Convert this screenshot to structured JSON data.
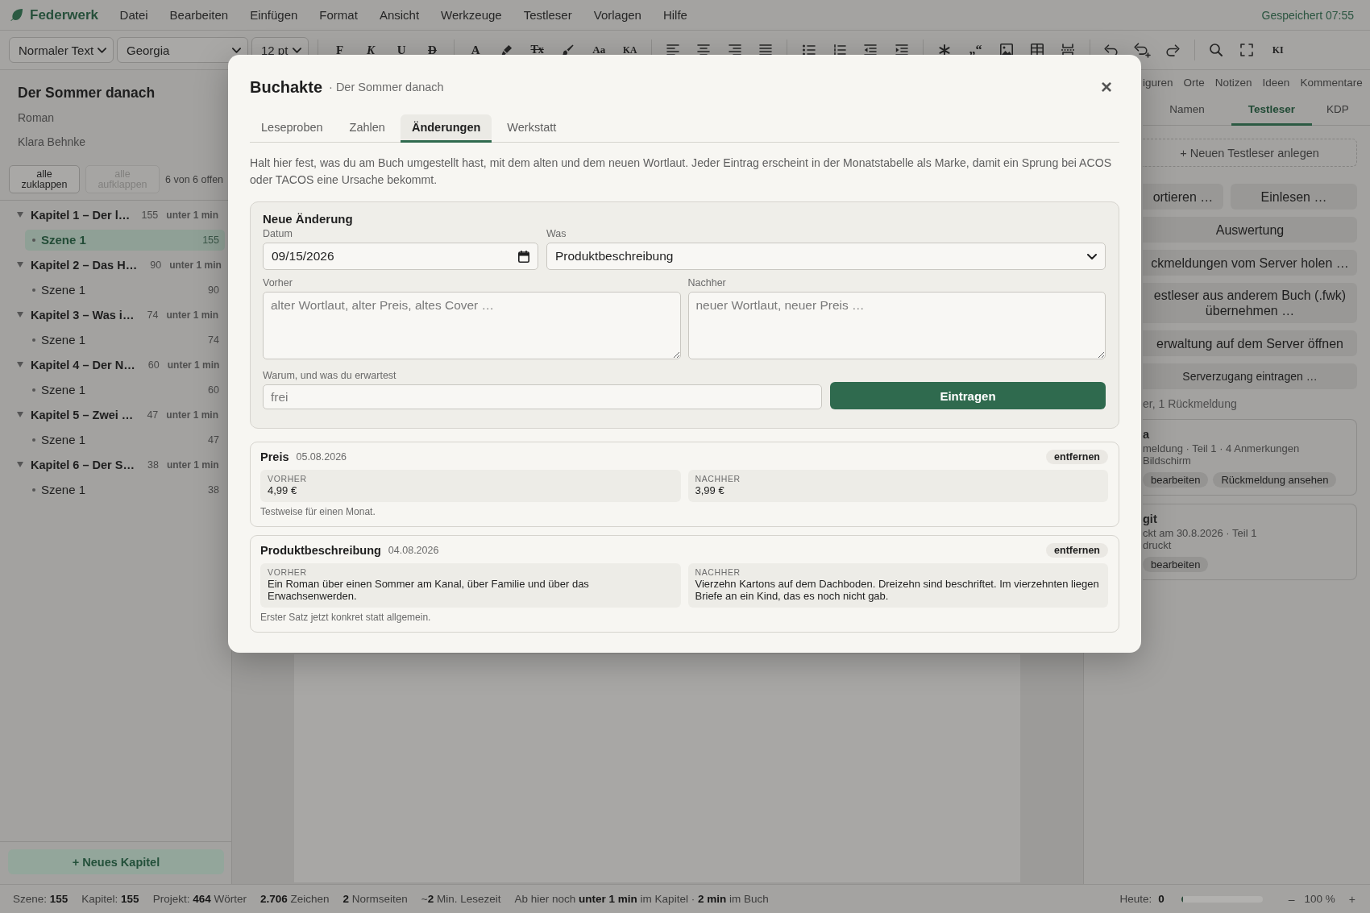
{
  "app": {
    "name": "Federwerk",
    "save_status": "Gespeichert 07:55"
  },
  "menu": [
    "Datei",
    "Bearbeiten",
    "Einfügen",
    "Format",
    "Ansicht",
    "Werkzeuge",
    "Testleser",
    "Vorlagen",
    "Hilfe"
  ],
  "toolbar": {
    "selects": [
      {
        "kind": "style",
        "value": "Normaler Text"
      },
      {
        "kind": "font",
        "value": "Georgia"
      },
      {
        "kind": "size",
        "value": "12 pt"
      }
    ],
    "groups": [
      [
        {
          "kind": "bold",
          "label": "F"
        },
        {
          "kind": "italic",
          "label": "K"
        },
        {
          "kind": "underline",
          "label": "U"
        },
        {
          "kind": "strike",
          "label": "D"
        }
      ],
      [
        {
          "kind": "color",
          "label": "A"
        },
        {
          "kind": "highlight"
        },
        {
          "kind": "clear",
          "label": "Tx"
        },
        {
          "kind": "brush"
        },
        {
          "kind": "case",
          "label": "Aa"
        },
        {
          "kind": "smallcaps",
          "label": "KA"
        }
      ],
      [
        {
          "kind": "align-left"
        },
        {
          "kind": "align-center"
        },
        {
          "kind": "align-right"
        },
        {
          "kind": "justify"
        }
      ],
      [
        {
          "kind": "bullets"
        },
        {
          "kind": "numbers"
        },
        {
          "kind": "outdent"
        },
        {
          "kind": "indent"
        }
      ],
      [
        {
          "kind": "special"
        },
        {
          "kind": "quotes",
          "label": "„“"
        },
        {
          "kind": "image"
        },
        {
          "kind": "table"
        },
        {
          "kind": "pagebreak"
        }
      ],
      [
        {
          "kind": "undo"
        },
        {
          "kind": "undo-all"
        },
        {
          "kind": "redo"
        }
      ],
      [
        {
          "kind": "search"
        },
        {
          "kind": "fullscreen"
        },
        {
          "kind": "ai",
          "label": "KI"
        }
      ]
    ]
  },
  "book": {
    "title": "Der Sommer danach",
    "genre": "Roman",
    "author": "Klara Behnke"
  },
  "outline": {
    "buttons": [
      {
        "label": "alle zuklappen",
        "disabled": false
      },
      {
        "label": "alle aufklappen",
        "disabled": true
      }
    ],
    "open_count": "6 von 6 offen",
    "chapters": [
      {
        "title": "Kapitel 1 – Der l…",
        "words": "155",
        "time": "unter 1 min",
        "expanded": true,
        "children": [
          {
            "title": "Szene 1",
            "words": "155",
            "selected": true
          }
        ]
      },
      {
        "title": "Kapitel 2 – Das H…",
        "words": "90",
        "time": "unter 1 min",
        "expanded": true,
        "children": [
          {
            "title": "Szene 1",
            "words": "90",
            "selected": false
          }
        ]
      },
      {
        "title": "Kapitel 3 – Was i…",
        "words": "74",
        "time": "unter 1 min",
        "expanded": true,
        "children": [
          {
            "title": "Szene 1",
            "words": "74",
            "selected": false
          }
        ]
      },
      {
        "title": "Kapitel 4 – Der N…",
        "words": "60",
        "time": "unter 1 min",
        "expanded": true,
        "children": [
          {
            "title": "Szene 1",
            "words": "60",
            "selected": false
          }
        ]
      },
      {
        "title": "Kapitel 5 – Zwei …",
        "words": "47",
        "time": "unter 1 min",
        "expanded": true,
        "children": [
          {
            "title": "Szene 1",
            "words": "47",
            "selected": false
          }
        ]
      },
      {
        "title": "Kapitel 6 – Der S…",
        "words": "38",
        "time": "unter 1 min",
        "expanded": true,
        "children": [
          {
            "title": "Szene 1",
            "words": "38",
            "selected": false
          }
        ]
      }
    ],
    "add_button": "+ Neues Kapitel"
  },
  "panel": {
    "tabs_top": [
      {
        "label": "iguren",
        "selected": false
      },
      {
        "label": "Orte",
        "selected": false
      },
      {
        "label": "Notizen",
        "selected": false
      },
      {
        "label": "Ideen",
        "selected": false
      },
      {
        "label": "Kommentare",
        "selected": false
      }
    ],
    "tabs": [
      {
        "label": "Namen",
        "selected": false
      },
      {
        "label": "Testleser",
        "selected": true
      },
      {
        "label": "KDP",
        "selected": false
      }
    ],
    "add_button": "+ Neuen Testleser anlegen",
    "actions": [
      [
        {
          "label": "ortieren …",
          "kind": "primary"
        },
        {
          "label": "Einlesen …",
          "kind": "primary"
        }
      ],
      [
        {
          "label": "Auswertung",
          "kind": "primary"
        }
      ],
      [
        {
          "label": "ckmeldungen vom Server holen …",
          "kind": "primary"
        }
      ],
      [
        {
          "label": "estleser aus anderem Buch (.fwk) übernehmen …",
          "kind": "primary"
        }
      ],
      [
        {
          "label": "erwaltung auf dem Server öffnen",
          "kind": "primary"
        }
      ],
      [
        {
          "label": "Serverzugang eintragen …",
          "kind": "secondary"
        }
      ]
    ],
    "summary": "er, 1 Rückmeldung",
    "readers": [
      {
        "name": "a",
        "details": [
          "meldung · Teil 1 · 4 Anmerkungen",
          "Bildschirm"
        ],
        "actions": [
          "bearbeiten",
          "Rückmeldung ansehen"
        ]
      },
      {
        "name": "git",
        "details": [
          "ckt am 30.8.2026 · Teil 1",
          "druckt"
        ],
        "actions": [
          "bearbeiten"
        ]
      }
    ]
  },
  "status_bar": {
    "items": [
      "Szene: **155**",
      "Kapitel: **155**",
      "Projekt: **464** Wörter",
      "**2.706** Zeichen",
      "**2** Normseiten",
      "~**2** Min. Lesezeit",
      "Ab hier noch **unter 1 min** im Kapitel · **2 min** im Buch"
    ],
    "today_label": "Heute:",
    "today_value": "0",
    "goal": {
      "level": 0.02
    },
    "zoom_out": "–",
    "zoom": "100 %",
    "zoom_in": "+"
  },
  "dialog": {
    "title": "Buchakte",
    "subtitle": "· Der Sommer danach",
    "close": "×",
    "tabs": [
      {
        "label": "Leseproben",
        "selected": false
      },
      {
        "label": "Zahlen",
        "selected": false
      },
      {
        "label": "Änderungen",
        "selected": true
      },
      {
        "label": "Werkstatt",
        "selected": false
      }
    ],
    "intro": "Halt hier fest, was du am Buch umgestellt hast, mit dem alten und dem neuen Wortlaut. Jeder Eintrag erscheint in der Monatstabelle als Marke, damit ein Sprung bei ACOS oder TACOS eine Ursache bekommt.",
    "form": {
      "title": "Neue Änderung",
      "date": {
        "label": "Datum",
        "value": "09/15/2026"
      },
      "field": {
        "label": "Was",
        "value": "Produktbeschreibung"
      },
      "before": {
        "label": "Vorher",
        "placeholder": "alter Wortlaut, alter Preis, altes Cover …"
      },
      "after": {
        "label": "Nachher",
        "placeholder": "neuer Wortlaut, neuer Preis …"
      },
      "reason": {
        "label": "Warum, und was du erwartest",
        "placeholder": "frei"
      },
      "submit": "Eintragen"
    },
    "entries": [
      {
        "field": "Preis",
        "date": "05.08.2026",
        "remove": "entfernen",
        "before": {
          "label": "VORHER",
          "value": "4,99 €"
        },
        "after": {
          "label": "NACHHER",
          "value": "3,99 €"
        },
        "note": "Testweise für einen Monat."
      },
      {
        "field": "Produktbeschreibung",
        "date": "04.08.2026",
        "remove": "entfernen",
        "before": {
          "label": "VORHER",
          "value": "Ein Roman über einen Sommer am Kanal, über Familie und über das Erwachsenwerden."
        },
        "after": {
          "label": "NACHHER",
          "value": "Vierzehn Kartons auf dem Dachboden. Dreizehn sind beschriftet. Im vierzehnten liegen Briefe an ein Kind, das es noch nicht gab."
        },
        "note": "Erster Satz jetzt konkret statt allgemein."
      }
    ]
  }
}
